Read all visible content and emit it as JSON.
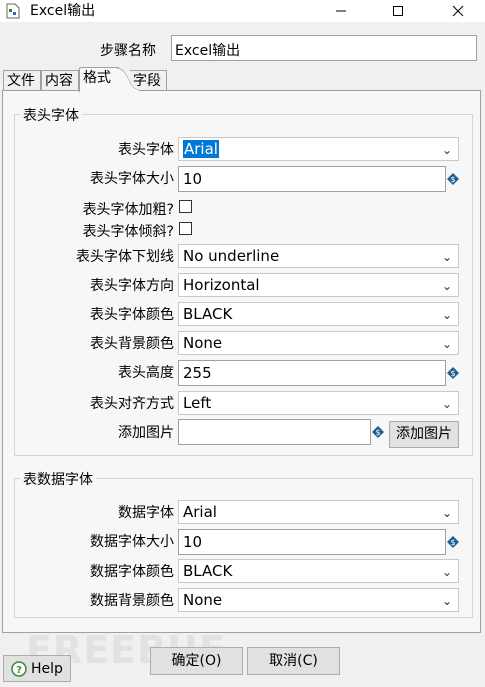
{
  "window": {
    "title": "Excel输出"
  },
  "step": {
    "label": "步骤名称",
    "value": "Excel输出"
  },
  "tabs": [
    {
      "label": "文件"
    },
    {
      "label": "内容"
    },
    {
      "label": "格式"
    },
    {
      "label": "字段"
    }
  ],
  "active_tab": "格式",
  "header_font": {
    "group_title": "表头字体",
    "font_label": "表头字体",
    "font_value": "Arial",
    "size_label": "表头字体大小",
    "size_value": "10",
    "bold_label": "表头字体加粗?",
    "italic_label": "表头字体倾斜?",
    "underline_label": "表头字体下划线",
    "underline_value": "No underline",
    "orientation_label": "表头字体方向",
    "orientation_value": "Horizontal",
    "color_label": "表头字体颜色",
    "color_value": "BLACK",
    "bg_label": "表头背景颜色",
    "bg_value": "None",
    "height_label": "表头高度",
    "height_value": "255",
    "align_label": "表头对齐方式",
    "align_value": "Left",
    "image_label": "添加图片",
    "image_value": "",
    "image_button": "添加图片"
  },
  "data_font": {
    "group_title": "表数据字体",
    "font_label": "数据字体",
    "font_value": "Arial",
    "size_label": "数据字体大小",
    "size_value": "10",
    "color_label": "数据字体颜色",
    "color_value": "BLACK",
    "bg_label": "数据背景颜色",
    "bg_value": "None"
  },
  "buttons": {
    "help": "Help",
    "ok": "确定(O)",
    "cancel": "取消(C)"
  },
  "watermark": "FREEBUF",
  "icons": {
    "variable": "dollar-diamond-icon",
    "help": "question-circle-icon",
    "app": "document-icon"
  },
  "colors": {
    "selection": "#0078d7",
    "variable_icon": "#1f5f8f"
  }
}
